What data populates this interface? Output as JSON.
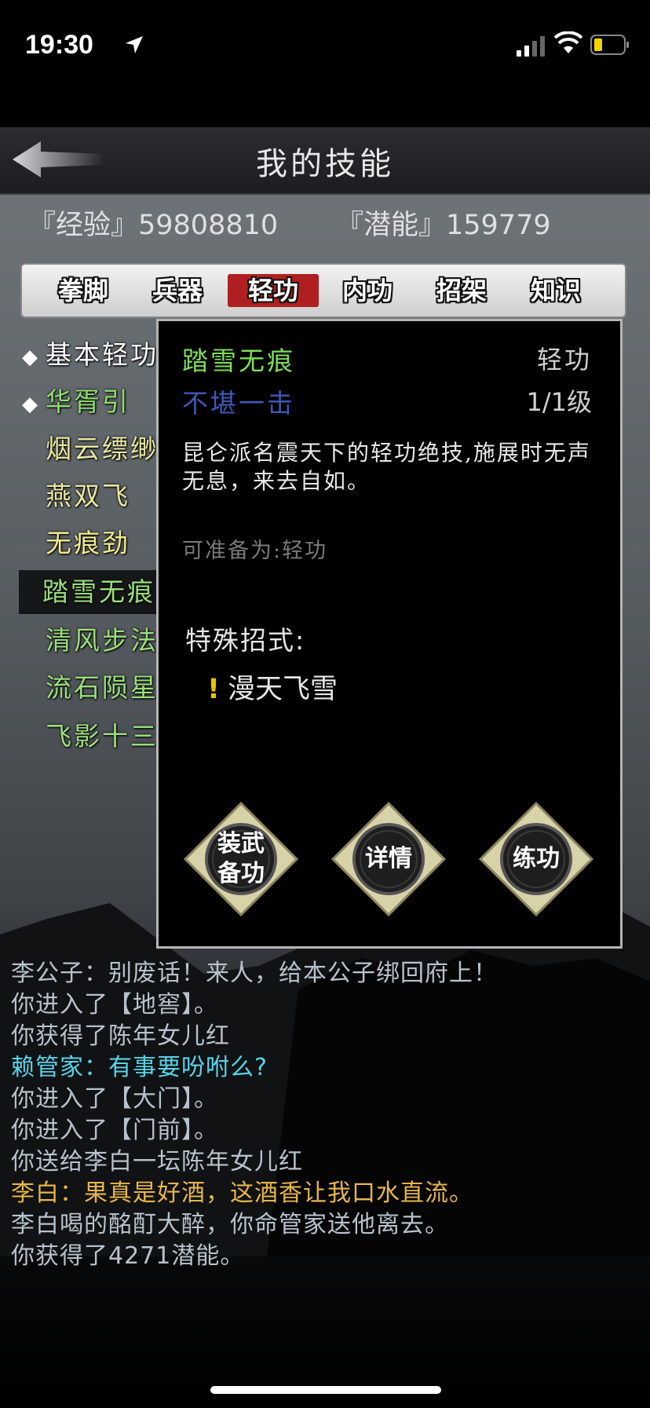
{
  "status": {
    "time": "19:30"
  },
  "header": {
    "title": "我的技能"
  },
  "stats": {
    "experience": "『经验』59808810",
    "potential": "『潜能』159779"
  },
  "tabs": [
    {
      "label": "拳脚",
      "active": false
    },
    {
      "label": "兵器",
      "active": false
    },
    {
      "label": "轻功",
      "active": true
    },
    {
      "label": "内功",
      "active": false
    },
    {
      "label": "招架",
      "active": false
    },
    {
      "label": "知识",
      "active": false
    }
  ],
  "skills": [
    {
      "marker": "◆",
      "name": "基本轻功",
      "color": "#ffffff"
    },
    {
      "marker": "◆",
      "name": "华胥引",
      "color": "#8ee06a"
    },
    {
      "marker": "",
      "name": "烟云缥缈",
      "color": "#e8e8a0"
    },
    {
      "marker": "",
      "name": "燕双飞",
      "color": "#e8e8a0"
    },
    {
      "marker": "",
      "name": "无痕劲",
      "color": "#f2ec8a"
    },
    {
      "marker": "",
      "name": "踏雪无痕",
      "color": "#9adf7a"
    },
    {
      "marker": "",
      "name": "清风步法",
      "color": "#9adf7a"
    },
    {
      "marker": "",
      "name": "流石陨星",
      "color": "#9adf7a"
    },
    {
      "marker": "",
      "name": "飞影十三",
      "color": "#9adf7a"
    }
  ],
  "detail": {
    "name": "踏雪无痕",
    "type": "轻功",
    "rank": "不堪一击",
    "level": "1/1级",
    "description": "昆仑派名震天下的轻功绝技,施展时无声无息，来去自如。",
    "prepare": "可准备为:轻功",
    "special_label": "特殊招式:",
    "special_move_marker": "!",
    "special_move": "漫天飞雪",
    "buttons": [
      {
        "label": "装武\n备功"
      },
      {
        "label": "详情"
      },
      {
        "label": "练功"
      }
    ]
  },
  "chat": [
    {
      "text": "李公子：别废话！来人，给本公子绑回府上！",
      "color": "#b8c2cc"
    },
    {
      "text": "你进入了【地窖】。",
      "color": "#b8c2cc"
    },
    {
      "text": "你获得了陈年女儿红",
      "color": "#b8c2cc"
    },
    {
      "text": "赖管家：有事要吩咐么?",
      "color": "#58d3e8"
    },
    {
      "text": "你进入了【大门】。",
      "color": "#b8c2cc"
    },
    {
      "text": "你进入了【门前】。",
      "color": "#b8c2cc"
    },
    {
      "text": "你送给李白一坛陈年女儿红",
      "color": "#b8c2cc"
    },
    {
      "text": "李白：果真是好酒，这酒香让我口水直流。",
      "color": "#e6b64a"
    },
    {
      "text": "李白喝的酩酊大醉，你命管家送他离去。",
      "color": "#b8c2cc"
    },
    {
      "text": "你获得了4271潜能。",
      "color": "#b8c2cc"
    }
  ]
}
